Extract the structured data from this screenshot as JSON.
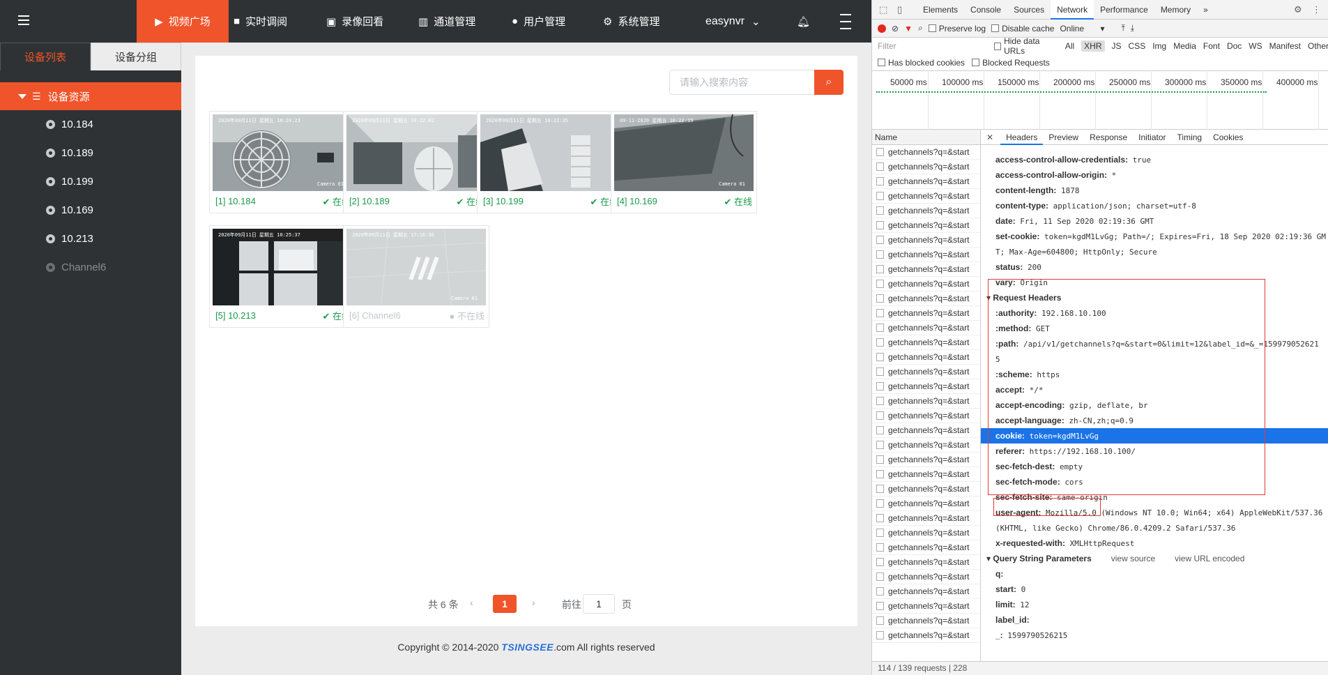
{
  "nav": {
    "items": [
      {
        "label": "视频广场",
        "icon": "play-icon"
      },
      {
        "label": "实时调阅",
        "icon": "camera-icon"
      },
      {
        "label": "录像回看",
        "icon": "replay-icon"
      },
      {
        "label": "通道管理",
        "icon": "channel-icon"
      },
      {
        "label": "用户管理",
        "icon": "user-icon"
      },
      {
        "label": "系统管理",
        "icon": "gear-icon"
      }
    ],
    "username": "easynvr",
    "accent": "#f0542a"
  },
  "sidebar": {
    "tabs": [
      "设备列表",
      "设备分组"
    ],
    "root": "设备资源",
    "devices": [
      {
        "label": "10.184",
        "online": true
      },
      {
        "label": "10.189",
        "online": true
      },
      {
        "label": "10.199",
        "online": true
      },
      {
        "label": "10.169",
        "online": true
      },
      {
        "label": "10.213",
        "online": true
      },
      {
        "label": "Channel6",
        "online": false
      }
    ]
  },
  "search": {
    "placeholder": "请输入搜索内容"
  },
  "cards": [
    {
      "name": "[1] 10.184",
      "status": "在线",
      "osd": "2020年09月11日  星期五  10:24:23",
      "cam": "Camera 01"
    },
    {
      "name": "[2] 10.189",
      "status": "在线",
      "osd": "2020年09月11日  星期五  10:22:02",
      "cam": ""
    },
    {
      "name": "[3] 10.199",
      "status": "在线",
      "osd": "2020年09月11日  星期五  10:22:35",
      "cam": ""
    },
    {
      "name": "[4] 10.169",
      "status": "在线",
      "osd": "09-11-2020  星期五  10:22:19",
      "cam": "Camera 01"
    },
    {
      "name": "[5] 10.213",
      "status": "在线",
      "osd": "2020年09月11日  星期五  10:25:37",
      "cam": ""
    },
    {
      "name": "[6] Channel6",
      "status": "不在线",
      "osd": "2020年09月11日  星期五  17:16:30",
      "cam": "Camera 01"
    }
  ],
  "pager": {
    "total": "共 6 条",
    "page": "1",
    "goto": "前往",
    "input": "1",
    "unit": "页"
  },
  "footer": {
    "pre": "Copyright © 2014-2020 ",
    "brand": "TSINGSEE",
    "post": ".com All rights reserved"
  },
  "devtools": {
    "tabs": [
      "Elements",
      "Console",
      "Sources",
      "Network",
      "Performance",
      "Memory",
      "»"
    ],
    "toolbar": {
      "preserve_log": "Preserve log",
      "disable_cache": "Disable cache",
      "throttle": "Online"
    },
    "filter": {
      "placeholder": "Filter",
      "hide_data": "Hide data URLs",
      "types": [
        "All",
        "XHR",
        "JS",
        "CSS",
        "Img",
        "Media",
        "Font",
        "Doc",
        "WS",
        "Manifest",
        "Other"
      ]
    },
    "filter2": {
      "blocked_cookies": "Has blocked cookies",
      "blocked_requests": "Blocked Requests"
    },
    "timeline_ticks": [
      "50000 ms",
      "100000 ms",
      "150000 ms",
      "200000 ms",
      "250000 ms",
      "300000 ms",
      "350000 ms",
      "400000 ms"
    ],
    "name_header": "Name",
    "request_name": "getchannels?q=&start",
    "request_count": 34,
    "status": "114 / 139 requests  |  228",
    "detail_tabs": [
      "Headers",
      "Preview",
      "Response",
      "Initiator",
      "Timing",
      "Cookies"
    ],
    "response_headers": [
      {
        "k": "access-control-allow-credentials:",
        "v": "true"
      },
      {
        "k": "access-control-allow-origin:",
        "v": "*"
      },
      {
        "k": "content-length:",
        "v": "1878"
      },
      {
        "k": "content-type:",
        "v": "application/json; charset=utf-8"
      },
      {
        "k": "date:",
        "v": "Fri, 11 Sep 2020 02:19:36 GMT"
      },
      {
        "k": "set-cookie:",
        "v": "token=kgdM1LvGg; Path=/; Expires=Fri, 18 Sep 2020 02:19:36 GM"
      },
      {
        "k": "",
        "v": "T; Max-Age=604800; HttpOnly; Secure"
      },
      {
        "k": "status:",
        "v": "200"
      },
      {
        "k": "vary:",
        "v": "Origin"
      }
    ],
    "request_headers_title": "Request Headers",
    "request_headers": [
      {
        "k": ":authority:",
        "v": "192.168.10.100"
      },
      {
        "k": ":method:",
        "v": "GET"
      },
      {
        "k": ":path:",
        "v": "/api/v1/getchannels?q=&start=0&limit=12&label_id=&_=159979052621"
      },
      {
        "k": "",
        "v": "5"
      },
      {
        "k": ":scheme:",
        "v": "https"
      },
      {
        "k": "accept:",
        "v": "*/*"
      },
      {
        "k": "accept-encoding:",
        "v": "gzip, deflate, br"
      },
      {
        "k": "accept-language:",
        "v": "zh-CN,zh;q=0.9"
      },
      {
        "k": "cookie:",
        "v": "token=kgdM1LvGg"
      },
      {
        "k": "referer:",
        "v": "https://192.168.10.100/"
      },
      {
        "k": "sec-fetch-dest:",
        "v": "empty"
      },
      {
        "k": "sec-fetch-mode:",
        "v": "cors"
      },
      {
        "k": "sec-fetch-site:",
        "v": "same-origin"
      },
      {
        "k": "user-agent:",
        "v": "Mozilla/5.0 (Windows NT 10.0; Win64; x64) AppleWebKit/537.36"
      },
      {
        "k": "",
        "v": "(KHTML, like Gecko) Chrome/86.0.4209.2 Safari/537.36"
      },
      {
        "k": "x-requested-with:",
        "v": "XMLHttpRequest"
      }
    ],
    "query_title": "Query String Parameters",
    "view_source": "view source",
    "view_url": "view URL encoded",
    "query": [
      {
        "k": "q:",
        "v": ""
      },
      {
        "k": "start:",
        "v": "0"
      },
      {
        "k": "limit:",
        "v": "12"
      },
      {
        "k": "label_id:",
        "v": ""
      },
      {
        "k": "_:",
        "v": "1599790526215"
      }
    ]
  }
}
